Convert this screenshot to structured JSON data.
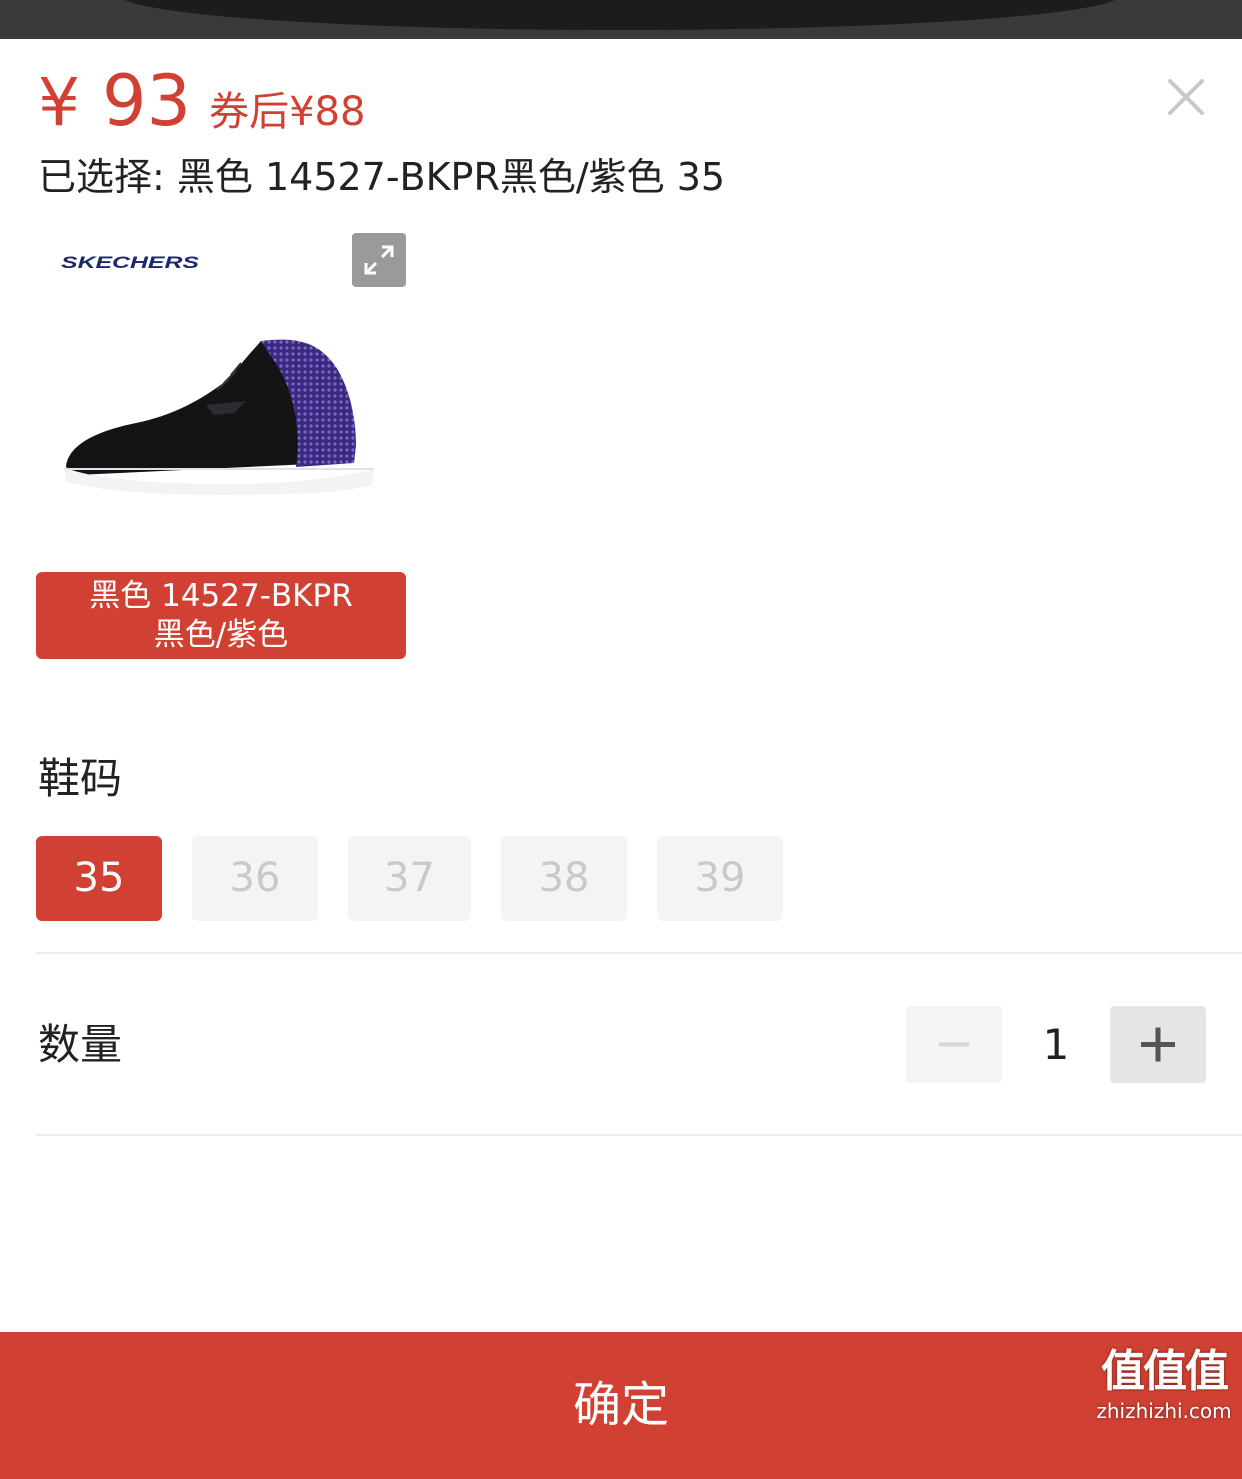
{
  "price": {
    "currency_symbol": "¥",
    "value": "93",
    "coupon_text": "券后¥88"
  },
  "selected": {
    "text": "已选择: 黑色 14527-BKPR黑色/紫色 35"
  },
  "product": {
    "brand": "SKECHERS",
    "variant_line1": "黑色 14527-BKPR",
    "variant_line2": "黑色/紫色"
  },
  "size_section": {
    "title": "鞋码",
    "options": [
      {
        "label": "35",
        "state": "selected"
      },
      {
        "label": "36",
        "state": "disabled"
      },
      {
        "label": "37",
        "state": "disabled"
      },
      {
        "label": "38",
        "state": "disabled"
      },
      {
        "label": "39",
        "state": "disabled"
      }
    ]
  },
  "quantity_section": {
    "title": "数量",
    "value": "1"
  },
  "confirm_button": {
    "label": "确定"
  },
  "watermark": {
    "top": "值值值",
    "bottom": "zhizhizhi.com"
  },
  "colors": {
    "accent": "#d14133",
    "chip_disabled_bg": "#f4f4f4",
    "text_primary": "#222222"
  },
  "icons": [
    "close-icon",
    "expand-icon",
    "minus-icon",
    "plus-icon"
  ]
}
